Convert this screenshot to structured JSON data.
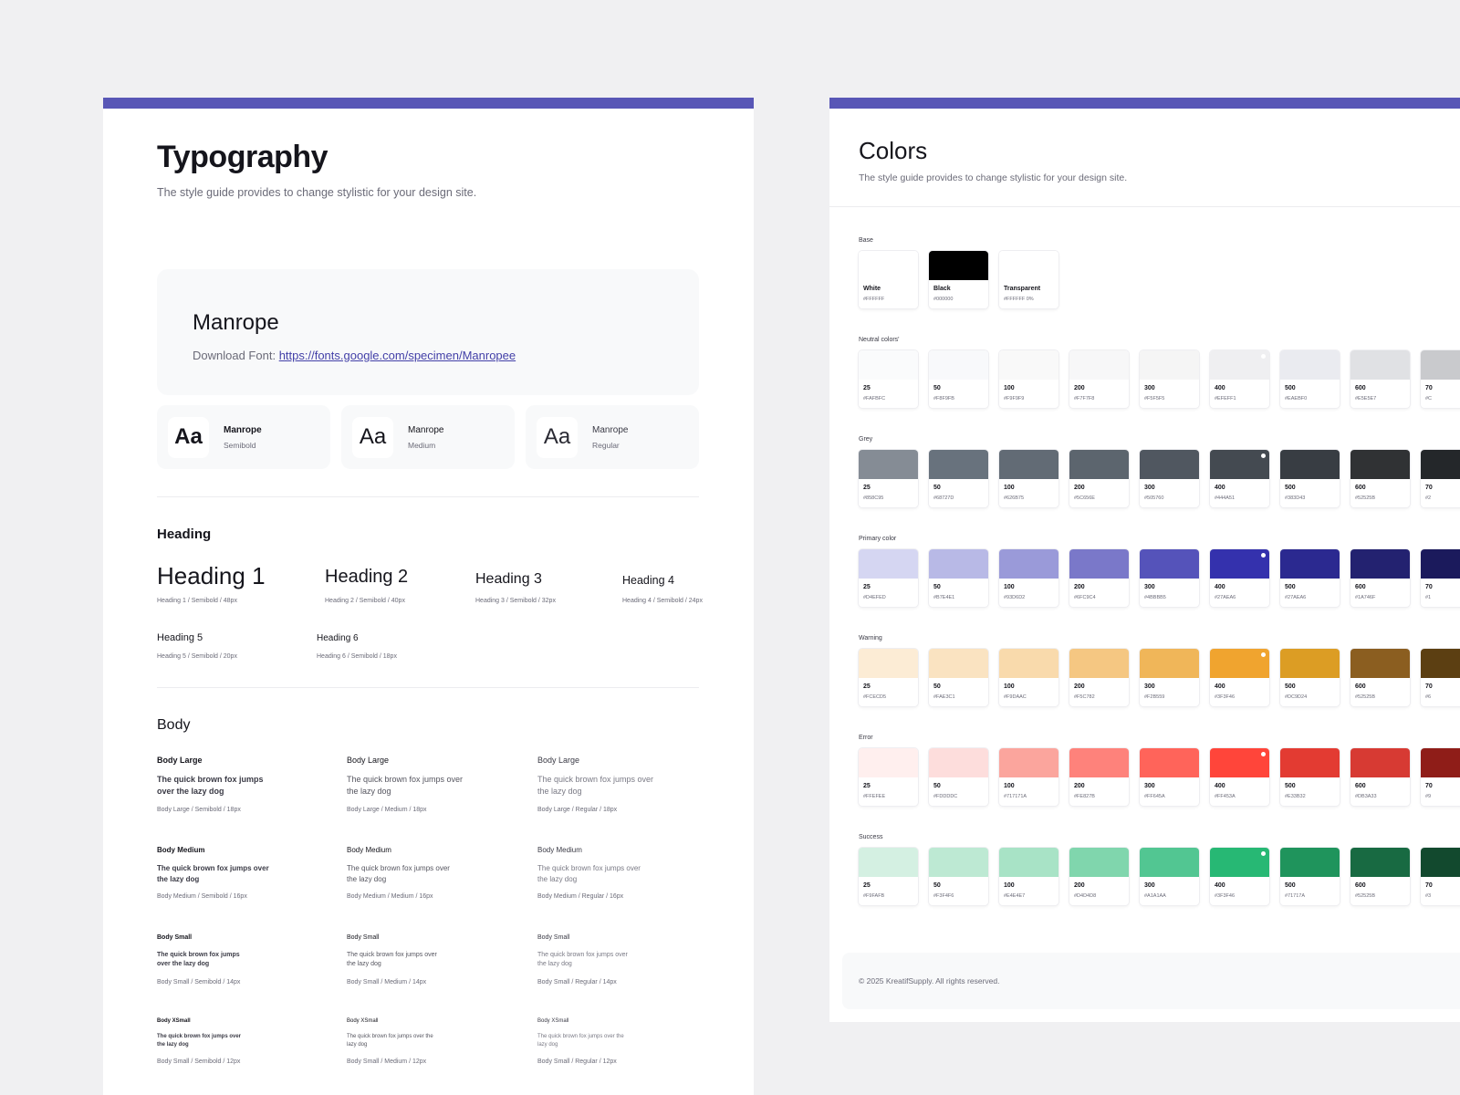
{
  "typography": {
    "title": "Typography",
    "subtitle": "The style guide provides to change stylistic for your design site.",
    "font_name": "Manrope",
    "download_label": "Download Font:",
    "download_url": "https://fonts.google.com/specimen/Manropee",
    "weights": [
      {
        "glyph": "Aa",
        "name": "Manrope",
        "weight": "Semibold"
      },
      {
        "glyph": "Aa",
        "name": "Manrope",
        "weight": "Medium"
      },
      {
        "glyph": "Aa",
        "name": "Manrope",
        "weight": "Regular"
      }
    ],
    "heading_section": "Heading",
    "headings": [
      {
        "label": "Heading 1",
        "meta": "Heading 1 / Semibold / 48px"
      },
      {
        "label": "Heading 2",
        "meta": "Heading 2 / Semibold / 40px"
      },
      {
        "label": "Heading 3",
        "meta": "Heading 3 / Semibold / 32px"
      },
      {
        "label": "Heading 4",
        "meta": "Heading 4 / Semibold / 24px"
      },
      {
        "label": "Heading 5",
        "meta": "Heading 5 / Semibold / 20px"
      },
      {
        "label": "Heading 6",
        "meta": "Heading 6 / Semibold / 18px"
      }
    ],
    "body_section": "Body",
    "body_groups": [
      {
        "label": "Body Large",
        "text": "The quick brown fox jumps over the lazy dog",
        "metas": [
          "Body Large / Semibold / 18px",
          "Body Large / Medium / 18px",
          "Body Large / Regular / 18px"
        ]
      },
      {
        "label": "Body Medium",
        "text": "The quick brown fox jumps over the lazy dog",
        "metas": [
          "Body Medium / Semibold / 16px",
          "Body Medium / Medium / 16px",
          "Body Medium / Regular / 16px"
        ]
      },
      {
        "label": "Body Small",
        "text": "The quick brown fox jumps over the lazy dog",
        "metas": [
          "Body Small / Semibold / 14px",
          "Body Small / Medium / 14px",
          "Body Small / Regular / 14px"
        ]
      },
      {
        "label": "Body XSmall",
        "text": "The quick brown fox jumps over the lazy dog",
        "metas": [
          "Body Small / Semibold / 12px",
          "Body Small / Medium / 12px",
          "Body Small / Regular / 12px"
        ]
      }
    ]
  },
  "colors": {
    "title": "Colors",
    "subtitle": "The style guide provides to change stylistic for your design site.",
    "footer": "© 2025 KreatifSupply. All rights reserved.",
    "groups": [
      {
        "label": "Base",
        "swatches": [
          {
            "name": "White",
            "hex": "#FFFFFF",
            "color": "#FFFFFF"
          },
          {
            "name": "Black",
            "hex": "#000000",
            "color": "#000000"
          },
          {
            "name": "Transparent",
            "hex": "#FFFFFF 0%",
            "color": "#FFFFFF"
          }
        ]
      },
      {
        "label": "Neutral colors'",
        "swatches": [
          {
            "name": "25",
            "hex": "#FAFBFC",
            "color": "#FAFBFC"
          },
          {
            "name": "50",
            "hex": "#F8F9FB",
            "color": "#F8F9FB"
          },
          {
            "name": "100",
            "hex": "#F9F9F9",
            "color": "#F9F9F9"
          },
          {
            "name": "200",
            "hex": "#F7F7F8",
            "color": "#F7F7F8"
          },
          {
            "name": "300",
            "hex": "#F5F5F5",
            "color": "#F5F5F5"
          },
          {
            "name": "400",
            "hex": "#EFEFF1",
            "color": "#EFEFF1",
            "dot": true
          },
          {
            "name": "500",
            "hex": "#EAEBF0",
            "color": "#EAEBF0"
          },
          {
            "name": "600",
            "hex": "#E5E5E7",
            "color": "#E0E1E4"
          },
          {
            "name": "70",
            "hex": "#C",
            "color": "#C9CACD"
          }
        ]
      },
      {
        "label": "Grey",
        "swatches": [
          {
            "name": "25",
            "hex": "#858C95",
            "color": "#858C95"
          },
          {
            "name": "50",
            "hex": "#68727D",
            "color": "#68727D"
          },
          {
            "name": "100",
            "hex": "#626B75",
            "color": "#626B75"
          },
          {
            "name": "200",
            "hex": "#5C656E",
            "color": "#5C656E"
          },
          {
            "name": "300",
            "hex": "#505760",
            "color": "#505760"
          },
          {
            "name": "400",
            "hex": "#444A51",
            "color": "#444A51",
            "dot": true
          },
          {
            "name": "500",
            "hex": "#383D43",
            "color": "#383D43"
          },
          {
            "name": "600",
            "hex": "#52525B",
            "color": "#303234"
          },
          {
            "name": "70",
            "hex": "#2",
            "color": "#24272A"
          }
        ]
      },
      {
        "label": "Primary color",
        "swatches": [
          {
            "name": "25",
            "hex": "#D4EFED",
            "color": "#D5D6F2"
          },
          {
            "name": "50",
            "hex": "#B7E4E1",
            "color": "#B8B9E6"
          },
          {
            "name": "100",
            "hex": "#93D6D2",
            "color": "#9A9AD9"
          },
          {
            "name": "200",
            "hex": "#6FC9C4",
            "color": "#7A78C9"
          },
          {
            "name": "300",
            "hex": "#4BBBB5",
            "color": "#5553BA"
          },
          {
            "name": "400",
            "hex": "#27AEA6",
            "color": "#3431AD",
            "dot": true
          },
          {
            "name": "500",
            "hex": "#27AEA6",
            "color": "#2B2990"
          },
          {
            "name": "600",
            "hex": "#1A746F",
            "color": "#232270"
          },
          {
            "name": "70",
            "hex": "#1",
            "color": "#1B1A5C"
          }
        ]
      },
      {
        "label": "Warning",
        "swatches": [
          {
            "name": "25",
            "hex": "#FCECD5",
            "color": "#FCECD5"
          },
          {
            "name": "50",
            "hex": "#FAE3C1",
            "color": "#FAE3C1"
          },
          {
            "name": "100",
            "hex": "#F9DAAC",
            "color": "#F9DAAC"
          },
          {
            "name": "200",
            "hex": "#F5C782",
            "color": "#F5C782"
          },
          {
            "name": "300",
            "hex": "#F2B559",
            "color": "#F0B659"
          },
          {
            "name": "400",
            "hex": "#3F3F46",
            "color": "#F0A42F",
            "dot": true
          },
          {
            "name": "500",
            "hex": "#DC9D24",
            "color": "#DC9D24"
          },
          {
            "name": "600",
            "hex": "#52525B",
            "color": "#8B5E20"
          },
          {
            "name": "70",
            "hex": "#6",
            "color": "#5C3F12"
          }
        ]
      },
      {
        "label": "Error",
        "swatches": [
          {
            "name": "25",
            "hex": "#FFEFEE",
            "color": "#FFEFEE"
          },
          {
            "name": "50",
            "hex": "#FDDDDC",
            "color": "#FDDDDC"
          },
          {
            "name": "100",
            "hex": "#717171A",
            "color": "#FBA59D"
          },
          {
            "name": "200",
            "hex": "#FE827B",
            "color": "#FE827B"
          },
          {
            "name": "300",
            "hex": "#FF645A",
            "color": "#FF645A"
          },
          {
            "name": "400",
            "hex": "#FF453A",
            "color": "#FF453A",
            "dot": true
          },
          {
            "name": "500",
            "hex": "#E33B32",
            "color": "#E33B32"
          },
          {
            "name": "600",
            "hex": "#DB3A33",
            "color": "#D73A33"
          },
          {
            "name": "70",
            "hex": "#9",
            "color": "#8F1D18"
          }
        ]
      },
      {
        "label": "Success",
        "swatches": [
          {
            "name": "25",
            "hex": "#F9FAFB",
            "color": "#D4F0E2"
          },
          {
            "name": "50",
            "hex": "#F3F4F6",
            "color": "#BDE9D3"
          },
          {
            "name": "100",
            "hex": "#E4E4E7",
            "color": "#A8E3C6"
          },
          {
            "name": "200",
            "hex": "#D4D4D8",
            "color": "#80D6AD"
          },
          {
            "name": "300",
            "hex": "#A1A1AA",
            "color": "#52C692"
          },
          {
            "name": "400",
            "hex": "#3F3F46",
            "color": "#27B874",
            "dot": true
          },
          {
            "name": "500",
            "hex": "#71717A",
            "color": "#1F945C"
          },
          {
            "name": "600",
            "hex": "#52525B",
            "color": "#186A42"
          },
          {
            "name": "70",
            "hex": "#3",
            "color": "#12492E"
          }
        ]
      }
    ]
  }
}
